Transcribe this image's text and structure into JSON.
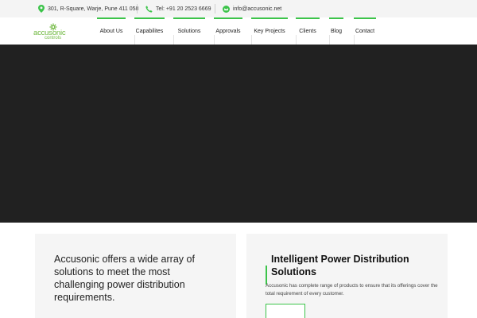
{
  "topbar": {
    "address": "301, R-Square, Warje, Pune 411 058",
    "phone": "Tel: +91 20 2523 6669",
    "email": "info@accusonic.net",
    "icons": [
      "location-pin-icon",
      "phone-icon",
      "envelope-icon"
    ]
  },
  "logo": {
    "line1": "accusonic",
    "line2": "controls"
  },
  "nav": {
    "items": [
      {
        "label": "About Us"
      },
      {
        "label": "Capabilites"
      },
      {
        "label": "Solutions"
      },
      {
        "label": "Approvals"
      },
      {
        "label": "Key Projects"
      },
      {
        "label": "Clients"
      },
      {
        "label": "Blog"
      },
      {
        "label": "Contact"
      }
    ]
  },
  "intro": {
    "text": "Accusonic offers a wide array of solutions to meet the most challenging power distribution requirements."
  },
  "solutions": {
    "title": "Intelligent Power Distribution Solutions",
    "body": "Accusonic has complete range of products to ensure that its offerings cover the total requirement of every customer."
  },
  "colors": {
    "accent": "#3cc44a",
    "logo": "#6fb83f",
    "hero": "#212121",
    "topbar": "#f4f4f4",
    "card": "#f5f5f5"
  }
}
